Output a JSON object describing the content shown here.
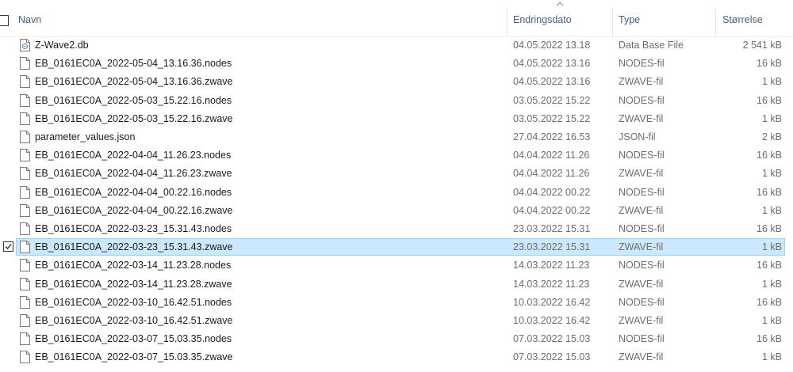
{
  "columns": {
    "name": "Navn",
    "date": "Endringsdato",
    "type": "Type",
    "size": "Størrelse"
  },
  "files": [
    {
      "name": "Z-Wave2.db",
      "date": "04.05.2022 13.18",
      "type": "Data Base File",
      "size": "2 541 kB",
      "icon": "database-file-icon",
      "selected": false
    },
    {
      "name": "EB_0161EC0A_2022-05-04_13.16.36.nodes",
      "date": "04.05.2022 13.16",
      "type": "NODES-fil",
      "size": "16 kB",
      "icon": "file-icon",
      "selected": false
    },
    {
      "name": "EB_0161EC0A_2022-05-04_13.16.36.zwave",
      "date": "04.05.2022 13.16",
      "type": "ZWAVE-fil",
      "size": "1 kB",
      "icon": "file-icon",
      "selected": false
    },
    {
      "name": "EB_0161EC0A_2022-05-03_15.22.16.nodes",
      "date": "03.05.2022 15.22",
      "type": "NODES-fil",
      "size": "16 kB",
      "icon": "file-icon",
      "selected": false
    },
    {
      "name": "EB_0161EC0A_2022-05-03_15.22.16.zwave",
      "date": "03.05.2022 15.22",
      "type": "ZWAVE-fil",
      "size": "1 kB",
      "icon": "file-icon",
      "selected": false
    },
    {
      "name": "parameter_values.json",
      "date": "27.04.2022 16.53",
      "type": "JSON-fil",
      "size": "2 kB",
      "icon": "file-icon",
      "selected": false
    },
    {
      "name": "EB_0161EC0A_2022-04-04_11.26.23.nodes",
      "date": "04.04.2022 11.26",
      "type": "NODES-fil",
      "size": "16 kB",
      "icon": "file-icon",
      "selected": false
    },
    {
      "name": "EB_0161EC0A_2022-04-04_11.26.23.zwave",
      "date": "04.04.2022 11.26",
      "type": "ZWAVE-fil",
      "size": "1 kB",
      "icon": "file-icon",
      "selected": false
    },
    {
      "name": "EB_0161EC0A_2022-04-04_00.22.16.nodes",
      "date": "04.04.2022 00.22",
      "type": "NODES-fil",
      "size": "16 kB",
      "icon": "file-icon",
      "selected": false
    },
    {
      "name": "EB_0161EC0A_2022-04-04_00.22.16.zwave",
      "date": "04.04.2022 00.22",
      "type": "ZWAVE-fil",
      "size": "1 kB",
      "icon": "file-icon",
      "selected": false
    },
    {
      "name": "EB_0161EC0A_2022-03-23_15.31.43.nodes",
      "date": "23.03.2022 15.31",
      "type": "NODES-fil",
      "size": "16 kB",
      "icon": "file-icon",
      "selected": false
    },
    {
      "name": "EB_0161EC0A_2022-03-23_15.31.43.zwave",
      "date": "23.03.2022 15.31",
      "type": "ZWAVE-fil",
      "size": "1 kB",
      "icon": "file-icon",
      "selected": true
    },
    {
      "name": "EB_0161EC0A_2022-03-14_11.23.28.nodes",
      "date": "14.03.2022 11.23",
      "type": "NODES-fil",
      "size": "16 kB",
      "icon": "file-icon",
      "selected": false
    },
    {
      "name": "EB_0161EC0A_2022-03-14_11.23.28.zwave",
      "date": "14.03.2022 11.23",
      "type": "ZWAVE-fil",
      "size": "1 kB",
      "icon": "file-icon",
      "selected": false
    },
    {
      "name": "EB_0161EC0A_2022-03-10_16.42.51.nodes",
      "date": "10.03.2022 16.42",
      "type": "NODES-fil",
      "size": "16 kB",
      "icon": "file-icon",
      "selected": false
    },
    {
      "name": "EB_0161EC0A_2022-03-10_16.42.51.zwave",
      "date": "10.03.2022 16.42",
      "type": "ZWAVE-fil",
      "size": "1 kB",
      "icon": "file-icon",
      "selected": false
    },
    {
      "name": "EB_0161EC0A_2022-03-07_15.03.35.nodes",
      "date": "07.03.2022 15.03",
      "type": "NODES-fil",
      "size": "16 kB",
      "icon": "file-icon",
      "selected": false
    },
    {
      "name": "EB_0161EC0A_2022-03-07_15.03.35.zwave",
      "date": "07.03.2022 15.03",
      "type": "ZWAVE-fil",
      "size": "1 kB",
      "icon": "file-icon",
      "selected": false
    }
  ],
  "colors": {
    "header_text": "#4c607a",
    "selection_fill": "#cce8ff",
    "selection_border": "#99d1ff"
  }
}
